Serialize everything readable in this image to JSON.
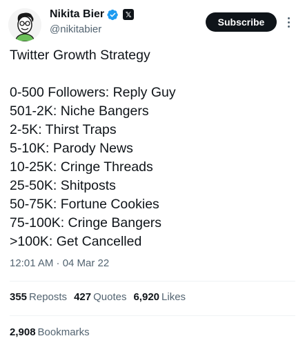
{
  "author": {
    "display_name": "Nikita Bier",
    "handle": "@nikitabier",
    "verified_badge_color": "#1d9bf0",
    "x_badge_text": "𝕏"
  },
  "actions": {
    "subscribe_label": "Subscribe"
  },
  "tweet": {
    "title": "Twitter Growth Strategy",
    "lines": [
      "0-500 Followers: Reply Guy",
      "501-2K: Niche Bangers",
      "2-5K: Thirst Traps",
      "5-10K: Parody News",
      "10-25K: Cringe Threads",
      "25-50K: Shitposts",
      "50-75K: Fortune Cookies",
      "75-100K: Cringe Bangers",
      ">100K: Get Cancelled"
    ],
    "timestamp": "12:01 AM · 04 Mar 22"
  },
  "stats": {
    "reposts_count": "355",
    "reposts_label": "Reposts",
    "quotes_count": "427",
    "quotes_label": "Quotes",
    "likes_count": "6,920",
    "likes_label": "Likes",
    "bookmarks_count": "2,908",
    "bookmarks_label": "Bookmarks"
  }
}
